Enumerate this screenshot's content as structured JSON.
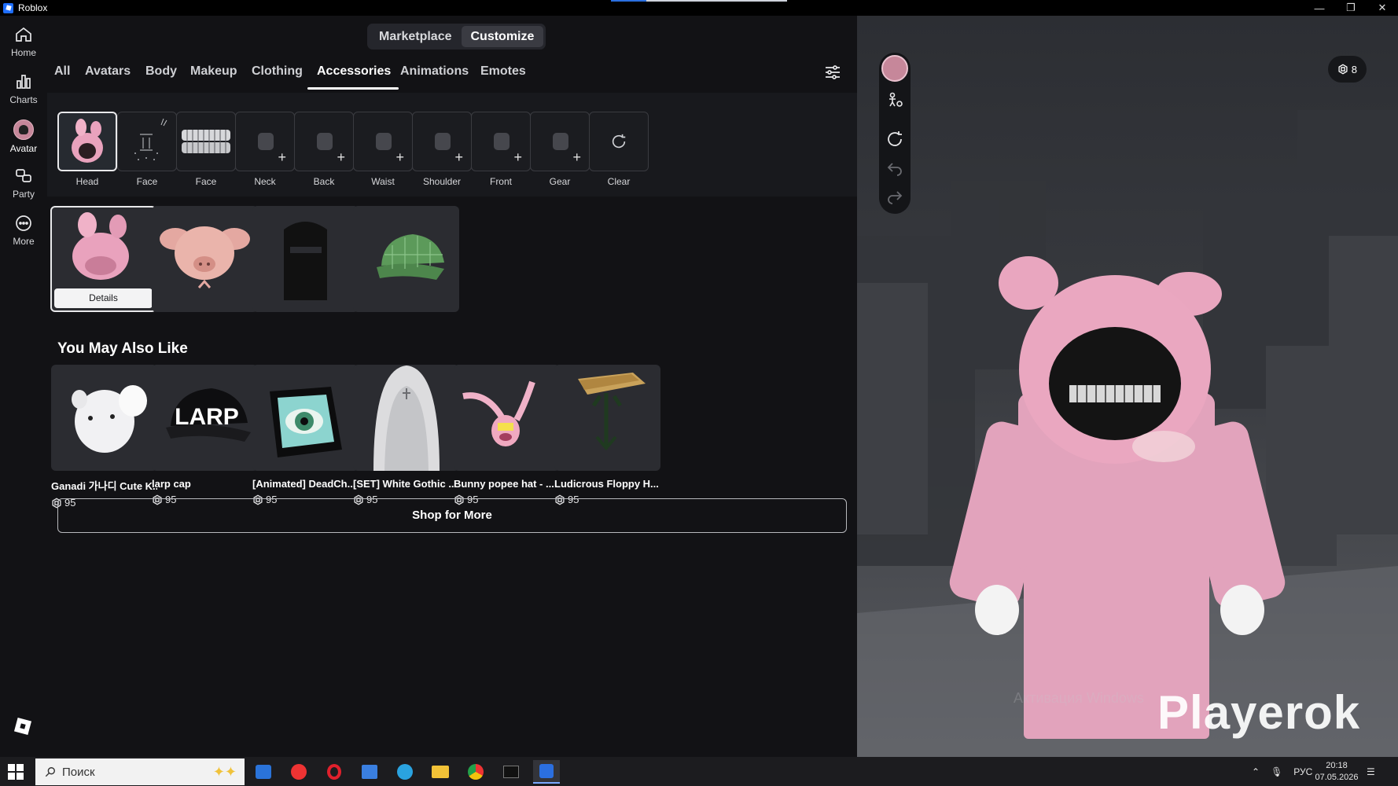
{
  "window": {
    "title": "Roblox"
  },
  "rail": {
    "items": [
      {
        "label": "Home",
        "icon": "home-icon"
      },
      {
        "label": "Charts",
        "icon": "chart-icon"
      },
      {
        "label": "Avatar",
        "icon": "avatar-icon"
      },
      {
        "label": "Party",
        "icon": "party-icon"
      },
      {
        "label": "More",
        "icon": "more-icon"
      }
    ]
  },
  "header": {
    "segments": [
      "Marketplace",
      "Customize"
    ],
    "active_segment": "Customize"
  },
  "tabs": [
    "All",
    "Avatars",
    "Body",
    "Makeup",
    "Clothing",
    "Accessories",
    "Animations",
    "Emotes"
  ],
  "active_tab": "Accessories",
  "slots": [
    {
      "label": "Head",
      "state": "equipped"
    },
    {
      "label": "Face",
      "state": "equipped"
    },
    {
      "label": "Face",
      "state": "equipped"
    },
    {
      "label": "Neck",
      "state": "empty"
    },
    {
      "label": "Back",
      "state": "empty"
    },
    {
      "label": "Waist",
      "state": "empty"
    },
    {
      "label": "Shoulder",
      "state": "empty"
    },
    {
      "label": "Front",
      "state": "empty"
    },
    {
      "label": "Gear",
      "state": "empty"
    },
    {
      "label": "Clear",
      "state": "action"
    }
  ],
  "owned_items": {
    "details_label": "Details",
    "items": [
      {
        "name": "pink bunny hood",
        "selected": true
      },
      {
        "name": "pig ear hat",
        "selected": false
      },
      {
        "name": "black veil",
        "selected": false
      },
      {
        "name": "green plaid cap",
        "selected": false
      }
    ]
  },
  "recommendations": {
    "title": "You May Also Like",
    "items": [
      {
        "name": "Ganadi 가나디 Cute K...",
        "price": "95"
      },
      {
        "name": "larp cap",
        "price": "95"
      },
      {
        "name": "[Animated] DeadCh...",
        "price": "95"
      },
      {
        "name": "[SET] White Gothic ...",
        "price": "95"
      },
      {
        "name": "Bunny popee hat - ...",
        "price": "95"
      },
      {
        "name": "Ludicrous Floppy H...",
        "price": "95"
      }
    ],
    "shop_more": "Shop for More"
  },
  "viewport": {
    "robux_balance": "8",
    "watermark": "Playerok",
    "activation_text": "Активация Windows"
  },
  "taskbar": {
    "search_placeholder": "Поиск",
    "language": "РУС",
    "time": "20:18",
    "date": "07.05.2026"
  },
  "colors": {
    "bg": "#121215",
    "panel": "#18191d",
    "card": "#2b2c31",
    "accent_pink": "#e9a2bd"
  }
}
